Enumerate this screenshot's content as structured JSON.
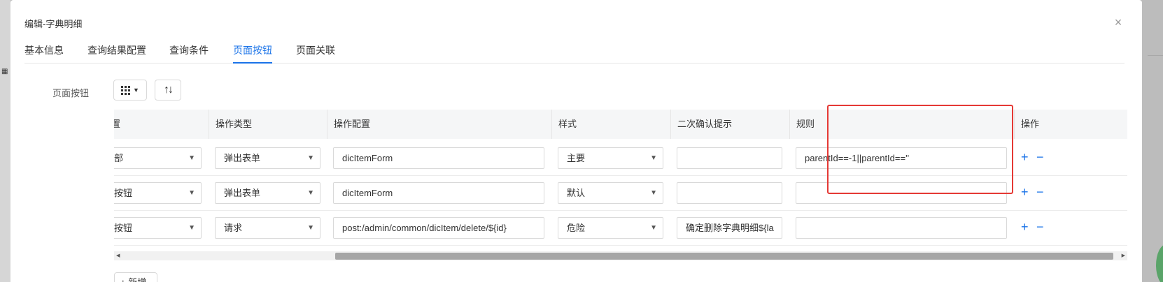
{
  "modal": {
    "title": "编辑-字典明细",
    "close_icon": "close-icon"
  },
  "tabs": [
    {
      "label": "基本信息",
      "active": false
    },
    {
      "label": "查询结果配置",
      "active": false
    },
    {
      "label": "查询条件",
      "active": false
    },
    {
      "label": "页面按钮",
      "active": true
    },
    {
      "label": "页面关联",
      "active": false
    }
  ],
  "form": {
    "label": "页面按钮"
  },
  "table": {
    "headers": [
      "置",
      "操作类型",
      "操作配置",
      "样式",
      "二次确认提示",
      "规则",
      "操作"
    ],
    "rows": [
      {
        "position": "顶部",
        "op_type": "弹出表单",
        "op_config": "dicItemForm",
        "style": "主要",
        "confirm": "",
        "rule": "parentId==-1||parentId==''"
      },
      {
        "position": "行按钮",
        "op_type": "弹出表单",
        "op_config": "dicItemForm",
        "style": "默认",
        "confirm": "",
        "rule": ""
      },
      {
        "position": "行按钮",
        "op_type": "请求",
        "op_config": "post:/admin/common/dicItem/delete/${id}",
        "style": "危险",
        "confirm": "确定删除字典明细${la",
        "rule": ""
      }
    ],
    "add_symbol": "+",
    "remove_symbol": "−"
  },
  "footer": {
    "add_button": "新增"
  },
  "colors": {
    "accent": "#1a73e8",
    "highlight": "#e53935"
  }
}
